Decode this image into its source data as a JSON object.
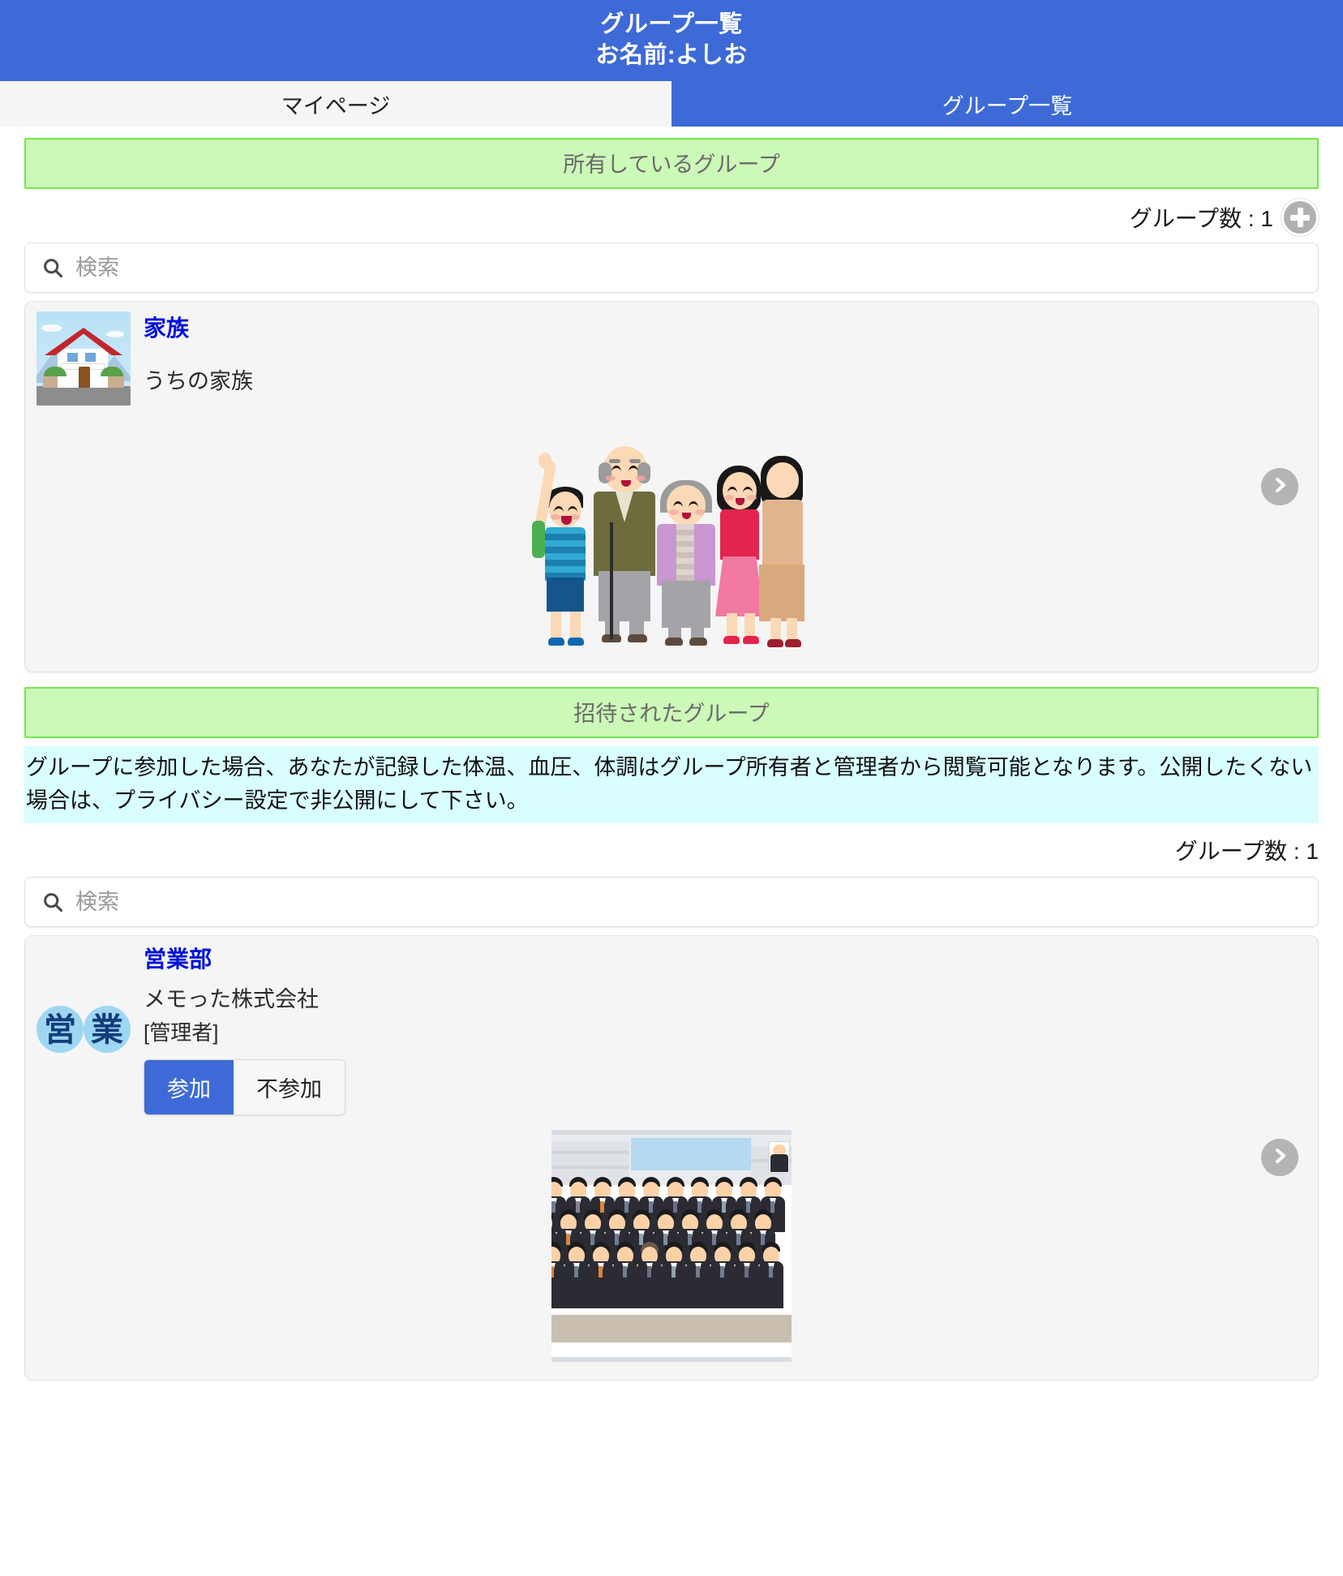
{
  "header": {
    "title": "グループ一覧",
    "subtitle": "お名前:よしお",
    "background_color": "#3d6ad6"
  },
  "tabs": [
    {
      "label": "マイページ",
      "active": false
    },
    {
      "label": "グループ一覧",
      "active": true
    }
  ],
  "sections": [
    {
      "banner": "所有しているグループ",
      "count_label": "グループ数 : 1",
      "has_add_button": true,
      "add_button_icon": "plus-icon",
      "search": {
        "placeholder": "検索",
        "value": "",
        "icon": "search-icon"
      },
      "group": {
        "name": "家族",
        "description": "うちの家族",
        "thumbnail_icon": "house-thumbnail",
        "illustration": "family-illustration",
        "chevron_icon": "chevron-right-icon"
      }
    },
    {
      "banner": "招待されたグループ",
      "notice": "グループに参加した場合、あなたが記録した体温、血圧、体調はグループ所有者と管理者から閲覧可能となります。公開したくない場合は、プライバシー設定で非公開にして下さい。",
      "count_label": "グループ数 : 1",
      "has_add_button": false,
      "search": {
        "placeholder": "検索",
        "value": "",
        "icon": "search-icon"
      },
      "group": {
        "name": "営業部",
        "description": "メモった株式会社",
        "role": "[管理者]",
        "thumbnail_icon": "eigyo-badge-thumbnail",
        "illustration": "company-group-photo",
        "chevron_icon": "chevron-right-icon",
        "join_button": "参加",
        "decline_button": "不参加",
        "selected": "参加"
      }
    }
  ],
  "colors": {
    "primary": "#3d6ad6",
    "banner_bg": "#ccf8b8",
    "banner_border": "#71e84a",
    "notice_bg": "#d9feff",
    "group_link": "#0011dd"
  }
}
